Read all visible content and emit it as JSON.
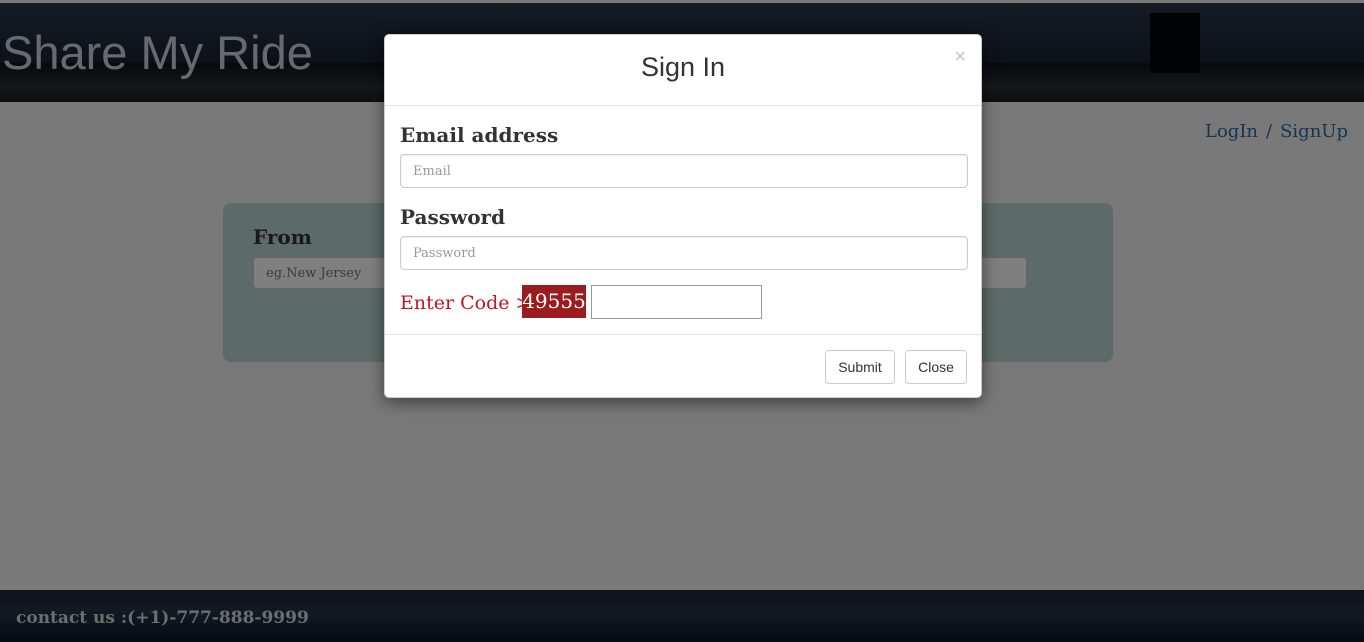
{
  "page": {
    "site_title": "Share My Ride",
    "nav": {
      "login": "LogIn",
      "separator": "/",
      "signup": "SignUp"
    },
    "search": {
      "from_label": "From",
      "from_placeholder": "eg.New Jersey"
    },
    "footer": {
      "contact": "contact us :(+1)-777-888-9999"
    }
  },
  "modal": {
    "title": "Sign In",
    "close_symbol": "×",
    "email_label": "Email address",
    "email_placeholder": "Email",
    "password_label": "Password",
    "password_placeholder": "Password",
    "code_label": "Enter Code >",
    "code_value": "49555",
    "submit_label": "Submit",
    "close_label": "Close"
  },
  "colors": {
    "code_text": "#c0161d",
    "code_badge": "#9b1c1f",
    "panel": "#b8d6d3",
    "link": "#2b6aa8"
  }
}
